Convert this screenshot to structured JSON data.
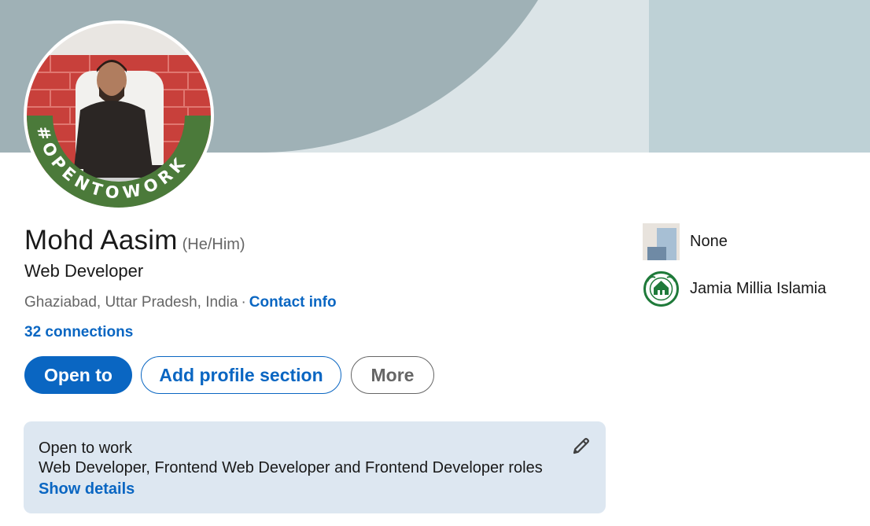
{
  "profile": {
    "name": "Mohd Aasim",
    "pronouns": "(He/Him)",
    "headline": "Web Developer",
    "location": "Ghaziabad, Uttar Pradesh, India",
    "separator": "·",
    "contact_info_label": "Contact info",
    "connections_label": "32 connections",
    "avatar_frame_text": "#OPENTOWORK"
  },
  "actions": {
    "open_to_label": "Open to",
    "add_section_label": "Add profile section",
    "more_label": "More"
  },
  "open_to_work": {
    "title": "Open to work",
    "roles": "Web Developer, Frontend Web Developer and Frontend Developer roles",
    "details_link": "Show details",
    "edit_icon": "pencil-icon"
  },
  "sidebar": {
    "items": [
      {
        "label": "None",
        "logo": "company-placeholder-logo"
      },
      {
        "label": "Jamia Millia Islamia",
        "logo": "university-logo"
      }
    ]
  },
  "colors": {
    "brand_blue": "#0a66c2",
    "open_to_work_green": "#4b7a3a",
    "cover_dark": "#9fb1b6",
    "cover_light": "#dbe4e7",
    "card_background": "#dde7f1"
  }
}
